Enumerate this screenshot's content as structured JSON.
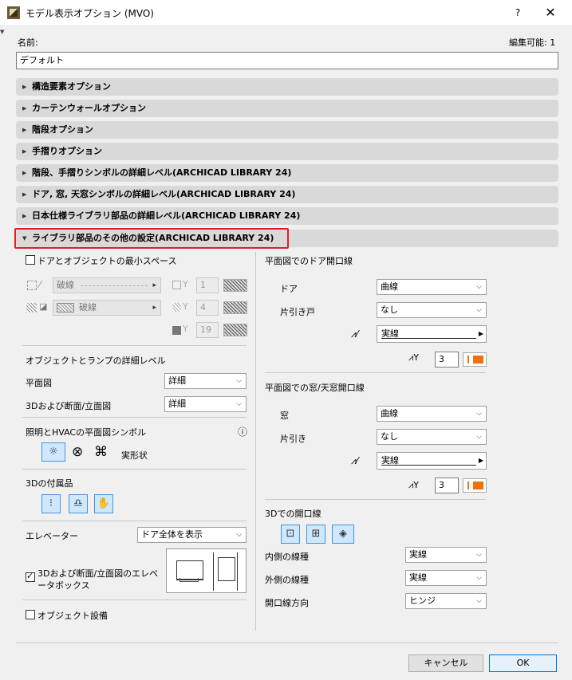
{
  "window": {
    "title": "モデル表示オプション (MVO)",
    "help": "?",
    "close": "✕"
  },
  "name_label": "名前:",
  "editable_label": "編集可能: 1",
  "name_value": "デフォルト",
  "sections": [
    {
      "label": "構造要素オプション",
      "expanded": false
    },
    {
      "label": "カーテンウォールオプション",
      "expanded": false
    },
    {
      "label": "階段オプション",
      "expanded": false
    },
    {
      "label": "手摺りオプション",
      "expanded": false
    },
    {
      "label": "階段、手摺りシンボルの詳細レベル(ARCHICAD LIBRARY 24)",
      "expanded": false
    },
    {
      "label": "ドア, 窓, 天窓シンボルの詳細レベル(ARCHICAD LIBRARY 24)",
      "expanded": false
    },
    {
      "label": "日本仕様ライブラリ部品の詳細レベル(ARCHICAD LIBRARY 24)",
      "expanded": false
    },
    {
      "label": "ライブラリ部品のその他の設定(ARCHICAD LIBRARY 24)",
      "expanded": true
    }
  ],
  "left": {
    "min_space": {
      "label": "ドアとオブジェクトの最小スペース",
      "checked": false
    },
    "line1": {
      "type": "破線",
      "pen": "1"
    },
    "fill": {
      "type": "破線",
      "pen": "4"
    },
    "bg_pen": "19",
    "detail_heading": "オブジェクトとランプの詳細レベル",
    "plan_label": "平面図",
    "plan_value": "詳細",
    "section_label": "3Dおよび断面/立面図",
    "section_value": "詳細",
    "hvac_heading": "照明とHVACの平面図シンボル",
    "info_icon": "ⓘ",
    "hvac_actual_label": "実形状",
    "acc_heading": "3Dの付属品",
    "elevator_label": "エレベーター",
    "elevator_value": "ドア全体を表示",
    "elevator_box_label": "3Dおよび断面/立面図のエレベータボックス",
    "elevator_box_checked": true,
    "object_equip_label": "オブジェクト設備",
    "object_equip_checked": false
  },
  "right": {
    "door_heading": "平面図でのドア開口線",
    "door_label": "ドア",
    "door_value": "曲線",
    "sliding_label": "片引き戸",
    "sliding_value": "なし",
    "door_line_type": "実線",
    "door_pen": "3",
    "window_heading": "平面図での窓/天窓開口線",
    "window_label": "窓",
    "window_value": "曲線",
    "win_sliding_label": "片引き",
    "win_sliding_value": "なし",
    "window_line_type": "実線",
    "window_pen": "3",
    "open3d_heading": "3Dでの開口線",
    "inner_label": "内側の線種",
    "inner_value": "実線",
    "outer_label": "外側の線種",
    "outer_value": "実線",
    "dir_label": "開口線方向",
    "dir_value": "ヒンジ"
  },
  "footer": {
    "cancel": "キャンセル",
    "ok": "OK"
  },
  "colors": {
    "highlight": "#e02020",
    "pen_orange": "#f07010",
    "active_icon": "#cde8ff"
  }
}
